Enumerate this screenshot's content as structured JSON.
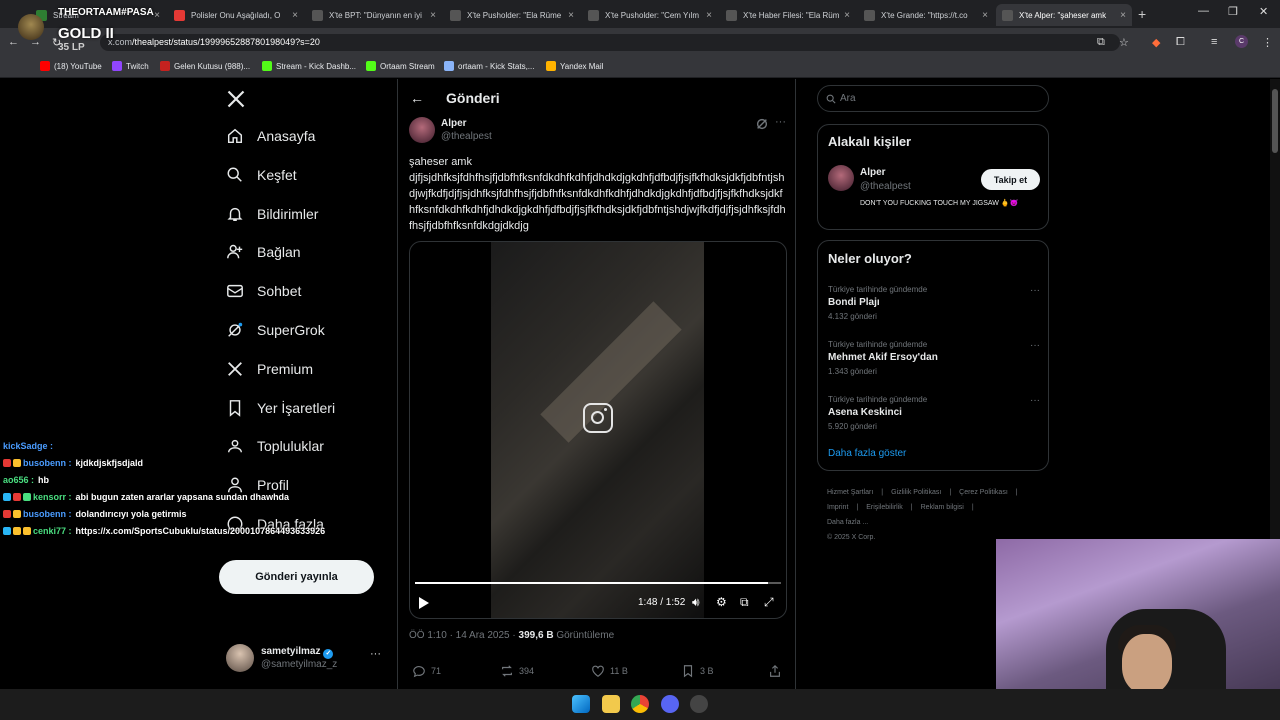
{
  "browser": {
    "tabs": [
      {
        "label": "Stream",
        "active": false
      },
      {
        "label": "Polisler Onu Aşağıladı, O",
        "active": false
      },
      {
        "label": "X'te BPT: \"Dünyanın en iyi",
        "active": false
      },
      {
        "label": "X'te Pusholder: \"Ela Rüme",
        "active": false
      },
      {
        "label": "X'te Pusholder: \"Cem Yılm",
        "active": false
      },
      {
        "label": "X'te Haber Filesi: \"Ela Rüm",
        "active": false
      },
      {
        "label": "X'te Grande: \"https://t.co",
        "active": false
      },
      {
        "label": "X'te Alper: \"şaheser amk",
        "active": true
      }
    ],
    "url_host": "x.com",
    "url_path": "/thealpest/status/1999965288780198049?s=20",
    "profile_initial": "C",
    "bookmarks": [
      {
        "label": "(18) YouTube",
        "color": "#ff0000"
      },
      {
        "label": "Twitch",
        "color": "#9146ff"
      },
      {
        "label": "Gelen Kutusu (988)...",
        "color": "#c5221f"
      },
      {
        "label": "Stream - Kick Dashb...",
        "color": "#53fc18"
      },
      {
        "label": "Ortaam Stream",
        "color": "#53fc18"
      },
      {
        "label": "ortaam - Kick Stats,...",
        "color": "#8ab4f8"
      },
      {
        "label": "Yandex Mail",
        "color": "#ffb300"
      }
    ]
  },
  "overlay": {
    "streamer_name": "THEORTAAM#PASA",
    "rank_tier": "GOLD II",
    "rank_lp": "35 LP"
  },
  "nav": {
    "items": [
      {
        "label": "Anasayfa",
        "icon": "home-icon"
      },
      {
        "label": "Keşfet",
        "icon": "search-icon"
      },
      {
        "label": "Bildirimler",
        "icon": "bell-icon"
      },
      {
        "label": "Bağlan",
        "icon": "person-add-icon"
      },
      {
        "label": "Sohbet",
        "icon": "mail-icon"
      },
      {
        "label": "SuperGrok",
        "icon": "grok-icon"
      },
      {
        "label": "Premium",
        "icon": "x-logo-icon"
      },
      {
        "label": "Yer İşaretleri",
        "icon": "bookmark-icon"
      },
      {
        "label": "Topluluklar",
        "icon": "communities-icon"
      },
      {
        "label": "Profil",
        "icon": "profile-icon"
      },
      {
        "label": "Daha fazla",
        "icon": "more-circle-icon"
      }
    ],
    "post_button": "Gönderi yayınla",
    "account": {
      "name": "sametyilmaz",
      "handle": "@sametyilmaz_z"
    }
  },
  "post": {
    "header_title": "Gönderi",
    "author_name": "Alper",
    "author_handle": "@thealpest",
    "text": "şaheser amk\ndjfjsjdhfksjfdhfhsjfjdbfhfksnfdkdhfkdhfjdhdkdjgkdhfjdfbdjfjsjfkfhdksjdkfjdbfntjshdjwjfkdfjdjfjsjdhfksjfdhfhsjfjdbfhfksnfdkdhfkdhfjdhdkdjgkdhfjdfbdjfjsjfkfhdksjdkfhfksnfdkdhfkdhfjdhdkdjgkdhfjdfbdjfjsjfkfhdksjdkfjdbfntjshdjwjfkdfjdjfjsjdhfksjfdhfhsjfjdbfhfksnfdkdgjdkdjg",
    "video": {
      "time": "1:48 / 1:52",
      "progress": 0.964
    },
    "meta_time": "ÖÖ 1:10 · 14 Ara 2025 · ",
    "meta_views": "399,6 B",
    "meta_views_label": " Görüntüleme",
    "actions": {
      "replies": "71",
      "reposts": "394",
      "likes": "11 B",
      "bookmarks": "3 B"
    }
  },
  "right": {
    "search_placeholder": "Ara",
    "related_title": "Alakalı kişiler",
    "related_person": {
      "name": "Alper",
      "handle": "@thealpest",
      "bio": "DON'T YOU FUCKING TOUCH MY JIGSAW 🖕😈",
      "follow_label": "Takip et"
    },
    "trends_title": "Neler oluyor?",
    "trends": [
      {
        "context": "Türkiye tarihinde gündemde",
        "name": "Bondi Plajı",
        "count": "4.132 gönderi"
      },
      {
        "context": "Türkiye tarihinde gündemde",
        "name": "Mehmet Akif Ersoy'dan",
        "count": "1.343 gönderi"
      },
      {
        "context": "Türkiye tarihinde gündemde",
        "name": "Asena Keskinci",
        "count": "5.920 gönderi"
      }
    ],
    "show_more": "Daha fazla göster",
    "footer": [
      "Hizmet Şartları",
      "|",
      "Gizlilik Politikası",
      "|",
      "Çerez Politikası",
      "|",
      "Imprint",
      "|",
      "Erişilebilirlik",
      "|",
      "Reklam bilgisi",
      "|",
      "Daha fazla ...",
      "© 2025 X Corp."
    ]
  },
  "chat": [
    {
      "user": "kickSadge",
      "user_color": "#4a9cff",
      "message": "",
      "badges": []
    },
    {
      "user": "busobenn",
      "user_color": "#4a9cff",
      "message": "kjdkdjskfjsdjald",
      "badges": [
        "#e53935",
        "#fbc02d"
      ]
    },
    {
      "user": "ao656",
      "user_color": "#4ade80",
      "message": "hb",
      "badges": []
    },
    {
      "user": "kensorr",
      "user_color": "#4ade80",
      "message": "abi bugun zaten ararlar yapsana sundan dhawhda",
      "badges": [
        "#29b6f6",
        "#e53935",
        "#4ade80"
      ]
    },
    {
      "user": "busobenn",
      "user_color": "#4a9cff",
      "message": "dolandırıcıyı yola getirmis",
      "badges": [
        "#e53935",
        "#fbc02d"
      ]
    },
    {
      "user": "cenki77",
      "user_color": "#4ade80",
      "message": "https://x.com/SportsCubuklu/status/2000107864493633926",
      "badges": [
        "#29b6f6",
        "#fbc02d",
        "#fbc02d"
      ]
    }
  ]
}
